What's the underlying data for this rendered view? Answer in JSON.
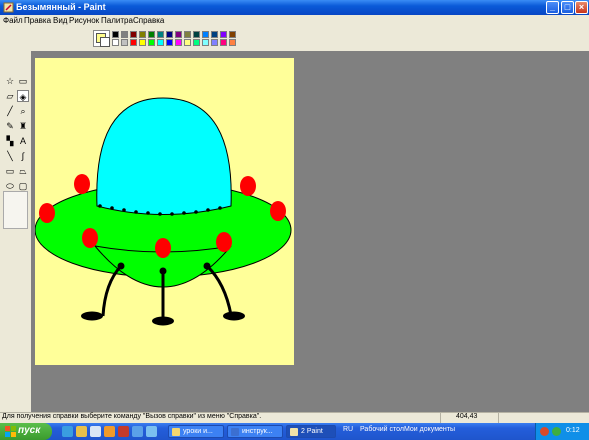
{
  "window": {
    "title": "Безымянный - Paint"
  },
  "titlebar_buttons": {
    "minimize": "_",
    "maximize": "□",
    "close": "×"
  },
  "menu": [
    "Файл",
    "Правка",
    "Вид",
    "Рисунок",
    "Палитра",
    "Справка"
  ],
  "palette": {
    "foreground": "#ffff99",
    "background": "#ffffff",
    "row1": [
      "#000000",
      "#808080",
      "#800000",
      "#808000",
      "#008000",
      "#008080",
      "#000080",
      "#800080",
      "#808040",
      "#004040",
      "#0080ff",
      "#004080",
      "#8000ff",
      "#804000"
    ],
    "row2": [
      "#ffffff",
      "#c0c0c0",
      "#ff0000",
      "#ffff00",
      "#00ff00",
      "#00ffff",
      "#0000ff",
      "#ff00ff",
      "#ffff80",
      "#00ff80",
      "#80ffff",
      "#8080ff",
      "#ff0080",
      "#ff8040"
    ]
  },
  "tools": [
    {
      "name": "free-form-select-icon",
      "glyph": "☆"
    },
    {
      "name": "rect-select-icon",
      "glyph": "▭"
    },
    {
      "name": "eraser-icon",
      "glyph": "▱"
    },
    {
      "name": "fill-icon",
      "glyph": "◈",
      "selected": true
    },
    {
      "name": "color-picker-icon",
      "glyph": "╱"
    },
    {
      "name": "magnifier-icon",
      "glyph": "⌕"
    },
    {
      "name": "pencil-icon",
      "glyph": "✎"
    },
    {
      "name": "brush-icon",
      "glyph": "♜"
    },
    {
      "name": "airbrush-icon",
      "glyph": "▚"
    },
    {
      "name": "text-icon",
      "glyph": "A"
    },
    {
      "name": "line-icon",
      "glyph": "╲"
    },
    {
      "name": "curve-icon",
      "glyph": "∫"
    },
    {
      "name": "rectangle-icon",
      "glyph": "▭"
    },
    {
      "name": "polygon-icon",
      "glyph": "⏢"
    },
    {
      "name": "ellipse-icon",
      "glyph": "⬭"
    },
    {
      "name": "rounded-rect-icon",
      "glyph": "▢"
    }
  ],
  "status": {
    "help": "Для получения справки выберите команду \"Вызов справки\" из меню \"Справка\".",
    "coords": "404,43"
  },
  "taskbar": {
    "start": "пуск",
    "tasks": [
      {
        "label": "уроки и...",
        "active": false
      },
      {
        "label": "инструк...",
        "active": false
      },
      {
        "label": "2 Paint",
        "active": true
      }
    ],
    "lang": "RU",
    "desktop_label": "Рабочий стол",
    "docs_label": "Мои документы",
    "clock": "0:12"
  }
}
